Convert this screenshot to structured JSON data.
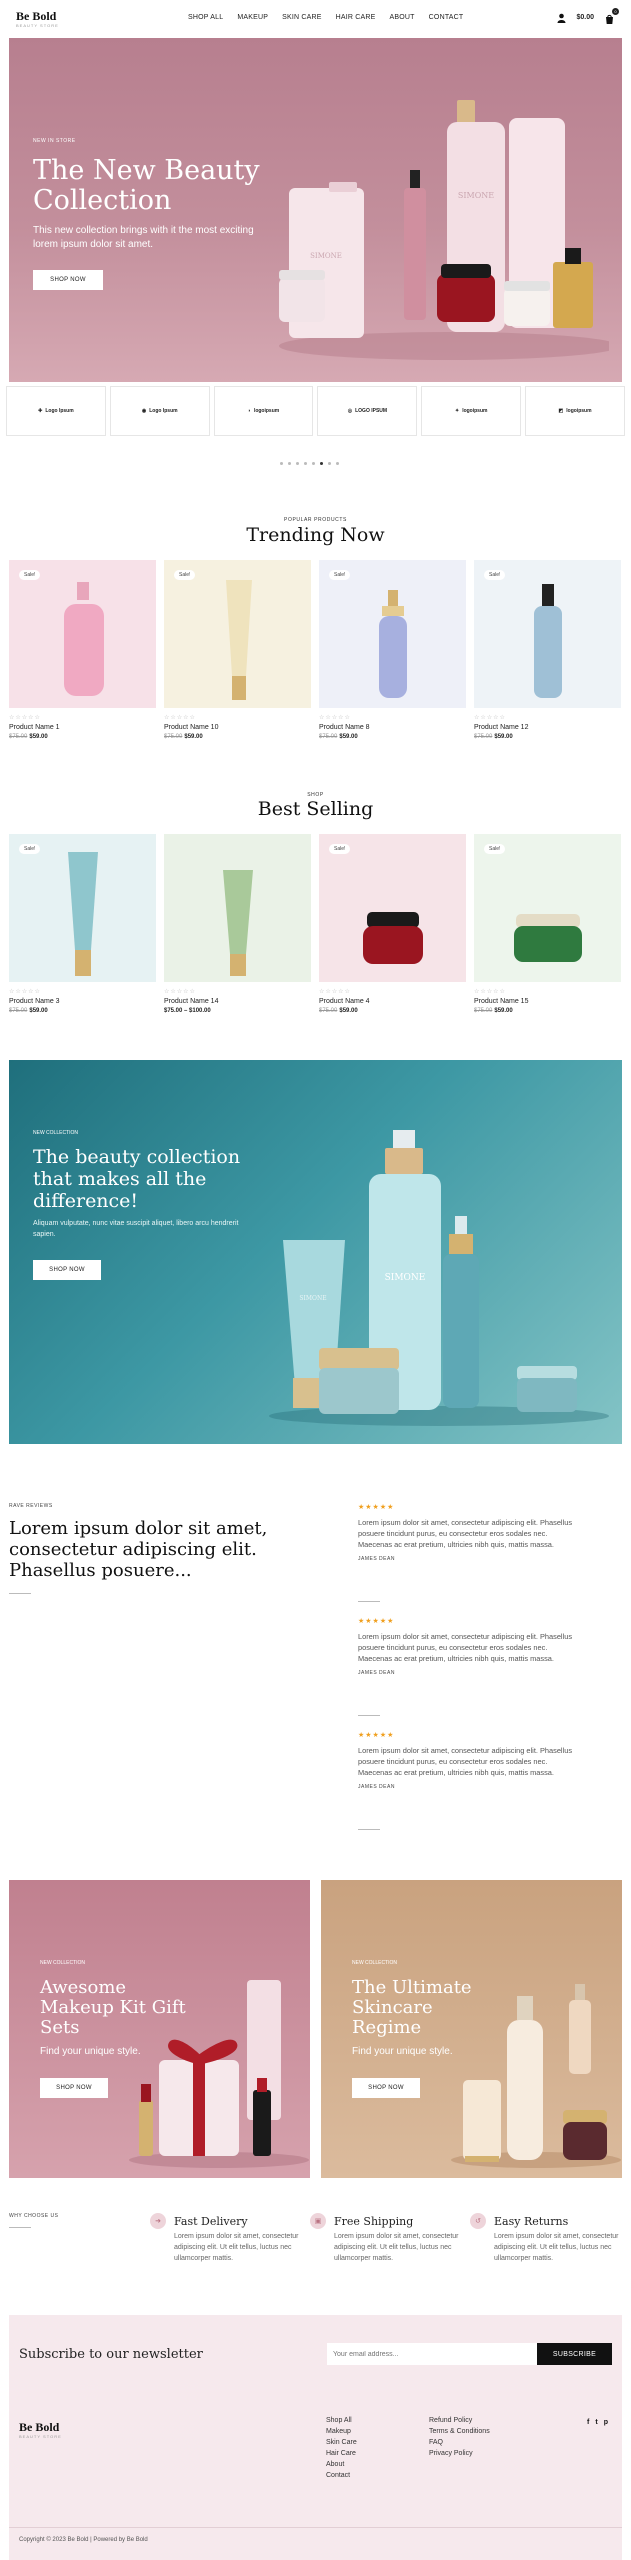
{
  "header": {
    "logo": "Be Bold",
    "logo_sub": "BEAUTY STORE",
    "nav": [
      "SHOP ALL",
      "MAKEUP",
      "SKIN CARE",
      "HAIR CARE",
      "ABOUT",
      "CONTACT"
    ],
    "cart_amount": "$0.00",
    "cart_count": "0"
  },
  "hero": {
    "eyebrow": "NEW IN STORE",
    "title": "The New Beauty Collection",
    "text": "This new collection brings with it the most exciting lorem ipsum dolor sit amet.",
    "button": "SHOP NOW",
    "brand_mark": "SIMONE"
  },
  "logos": [
    "Logo Ipsum",
    "Logo Ipsum",
    "logoipsum",
    "LOGO IPSUM",
    "logoipsum",
    "logoipsum"
  ],
  "trending": {
    "eyebrow": "POPULAR PRODUCTS",
    "title": "Trending Now",
    "products": [
      {
        "name": "Product Name 1",
        "old": "$75.00",
        "price": "$59.00",
        "sale": "Sale!",
        "stars": "☆☆☆☆☆",
        "bg": "#f7e1e8"
      },
      {
        "name": "Product Name 10",
        "old": "$75.00",
        "price": "$59.00",
        "sale": "Sale!",
        "stars": "☆☆☆☆☆",
        "bg": "#f6f1e0"
      },
      {
        "name": "Product Name 8",
        "old": "$75.00",
        "price": "$59.00",
        "sale": "Sale!",
        "stars": "☆☆☆☆☆",
        "bg": "#eef0f8"
      },
      {
        "name": "Product Name 12",
        "old": "$75.00",
        "price": "$59.00",
        "sale": "Sale!",
        "stars": "☆☆☆☆☆",
        "bg": "#eef3f7"
      }
    ]
  },
  "bestselling": {
    "eyebrow": "SHOP",
    "title": "Best Selling",
    "products": [
      {
        "name": "Product Name 3",
        "old": "$75.00",
        "price": "$59.00",
        "sale": "Sale!",
        "stars": "☆☆☆☆☆",
        "bg": "#e6f2f3"
      },
      {
        "name": "Product Name 14",
        "old": "",
        "price": "$75.00 – $100.00",
        "sale": "",
        "stars": "☆☆☆☆☆",
        "bg": "#eaf2e7"
      },
      {
        "name": "Product Name 4",
        "old": "$75.00",
        "price": "$59.00",
        "sale": "Sale!",
        "stars": "☆☆☆☆☆",
        "bg": "#f6e4e8"
      },
      {
        "name": "Product Name 15",
        "old": "$75.00",
        "price": "$59.00",
        "sale": "Sale!",
        "stars": "☆☆☆☆☆",
        "bg": "#edf5ec"
      }
    ]
  },
  "banner": {
    "eyebrow": "NEW COLLECTION",
    "title": "The beauty collection that makes all the difference!",
    "text": "Aliquam vulputate, nunc vitae suscipit aliquet, libero arcu hendrerit sapien.",
    "button": "SHOP NOW",
    "brand_mark": "SIMONE"
  },
  "testimonials": {
    "eyebrow": "RAVE REVIEWS",
    "headline": "Lorem ipsum dolor sit amet, consectetur adipiscing elit. Phasellus posuere...",
    "items": [
      {
        "stars": "★★★★★",
        "text": "Lorem ipsum dolor sit amet, consectetur adipiscing elit. Phasellus posuere tincidunt purus, eu consectetur eros sodales nec. Maecenas ac erat pretium, ultricies nibh quis, mattis massa.",
        "author": "JAMES DEAN"
      },
      {
        "stars": "★★★★★",
        "text": "Lorem ipsum dolor sit amet, consectetur adipiscing elit. Phasellus posuere tincidunt purus, eu consectetur eros sodales nec. Maecenas ac erat pretium, ultricies nibh quis, mattis massa.",
        "author": "JAMES DEAN"
      },
      {
        "stars": "★★★★★",
        "text": "Lorem ipsum dolor sit amet, consectetur adipiscing elit. Phasellus posuere tincidunt purus, eu consectetur eros sodales nec. Maecenas ac erat pretium, ultricies nibh quis, mattis massa.",
        "author": "JAMES DEAN"
      }
    ]
  },
  "promos": [
    {
      "eyebrow": "NEW COLLECTION",
      "title": "Awesome Makeup Kit Gift Sets",
      "text": "Find your unique style.",
      "button": "SHOP NOW"
    },
    {
      "eyebrow": "NEW COLLECTION",
      "title": "The Ultimate Skincare Regime",
      "text": "Find your unique style.",
      "button": "SHOP NOW"
    }
  ],
  "features": {
    "eyebrow": "WHY CHOOSE US",
    "items": [
      {
        "title": "Fast Delivery",
        "text": "Lorem ipsum dolor sit amet, consectetur adipiscing elit. Ut elit tellus, luctus nec ullamcorper mattis."
      },
      {
        "title": "Free Shipping",
        "text": "Lorem ipsum dolor sit amet, consectetur adipiscing elit. Ut elit tellus, luctus nec ullamcorper mattis."
      },
      {
        "title": "Easy Returns",
        "text": "Lorem ipsum dolor sit amet, consectetur adipiscing elit. Ut elit tellus, luctus nec ullamcorper mattis."
      }
    ]
  },
  "newsletter": {
    "title": "Subscribe to our newsletter",
    "placeholder": "Your email address...",
    "button": "SUBSCRIBE"
  },
  "footer": {
    "links1": [
      "Shop All",
      "Makeup",
      "Skin Care",
      "Hair Care",
      "About",
      "Contact"
    ],
    "links2": [
      "Refund Policy",
      "Terms & Conditions",
      "FAQ",
      "Privacy Policy"
    ],
    "copyright": "Copyright © 2023 Be Bold | Powered by Be Bold"
  }
}
